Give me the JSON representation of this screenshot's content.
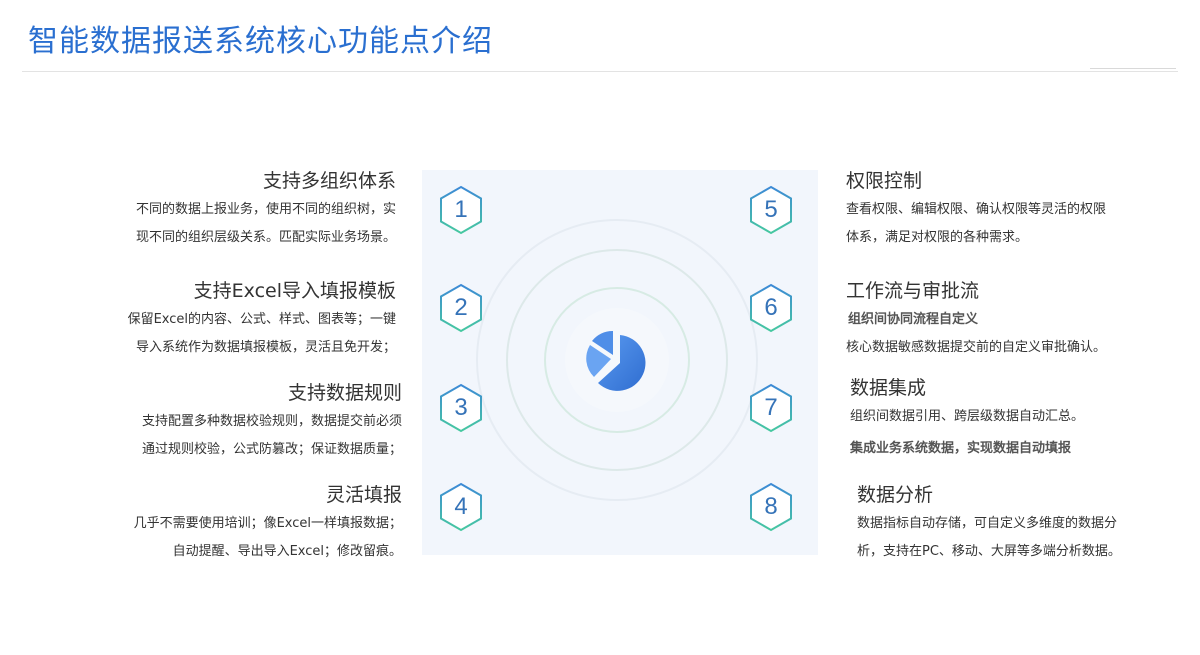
{
  "page": {
    "title": "智能数据报送系统核心功能点介绍"
  },
  "center": {
    "icon": "pie-chart-icon",
    "accent_color": "#3b78d8",
    "hex_border_color": "#3fb8a8"
  },
  "features": [
    {
      "num": "1",
      "title": "支持多组织体系",
      "lines": [
        "不同的数据上报业务，使用不同的组织树，实",
        "现不同的组织层级关系。匹配实际业务场景。"
      ]
    },
    {
      "num": "2",
      "title": "支持Excel导入填报模板",
      "lines": [
        "保留Excel的内容、公式、样式、图表等；一键",
        "导入系统作为数据填报模板，灵活且免开发；"
      ]
    },
    {
      "num": "3",
      "title": "支持数据规则",
      "lines": [
        "支持配置多种数据校验规则，数据提交前必须",
        "通过规则校验，公式防篡改；保证数据质量；"
      ]
    },
    {
      "num": "4",
      "title": "灵活填报",
      "lines": [
        "几乎不需要使用培训；像Excel一样填报数据；",
        "自动提醒、导出导入Excel；修改留痕。"
      ]
    },
    {
      "num": "5",
      "title": "权限控制",
      "lines": [
        "查看权限、编辑权限、确认权限等灵活的权限",
        "体系，满足对权限的各种需求。"
      ]
    },
    {
      "num": "6",
      "title": "工作流与审批流",
      "lines": [
        "组织间协同流程自定义",
        "核心数据敏感数据提交前的自定义审批确认。"
      ]
    },
    {
      "num": "7",
      "title": "数据集成",
      "lines": [
        "组织间数据引用、跨层级数据自动汇总。",
        "集成业务系统数据，实现数据自动填报"
      ]
    },
    {
      "num": "8",
      "title": "数据分析",
      "lines": [
        "数据指标自动存储，可自定义多维度的数据分",
        "析，支持在PC、移动、大屏等多端分析数据。"
      ]
    }
  ]
}
